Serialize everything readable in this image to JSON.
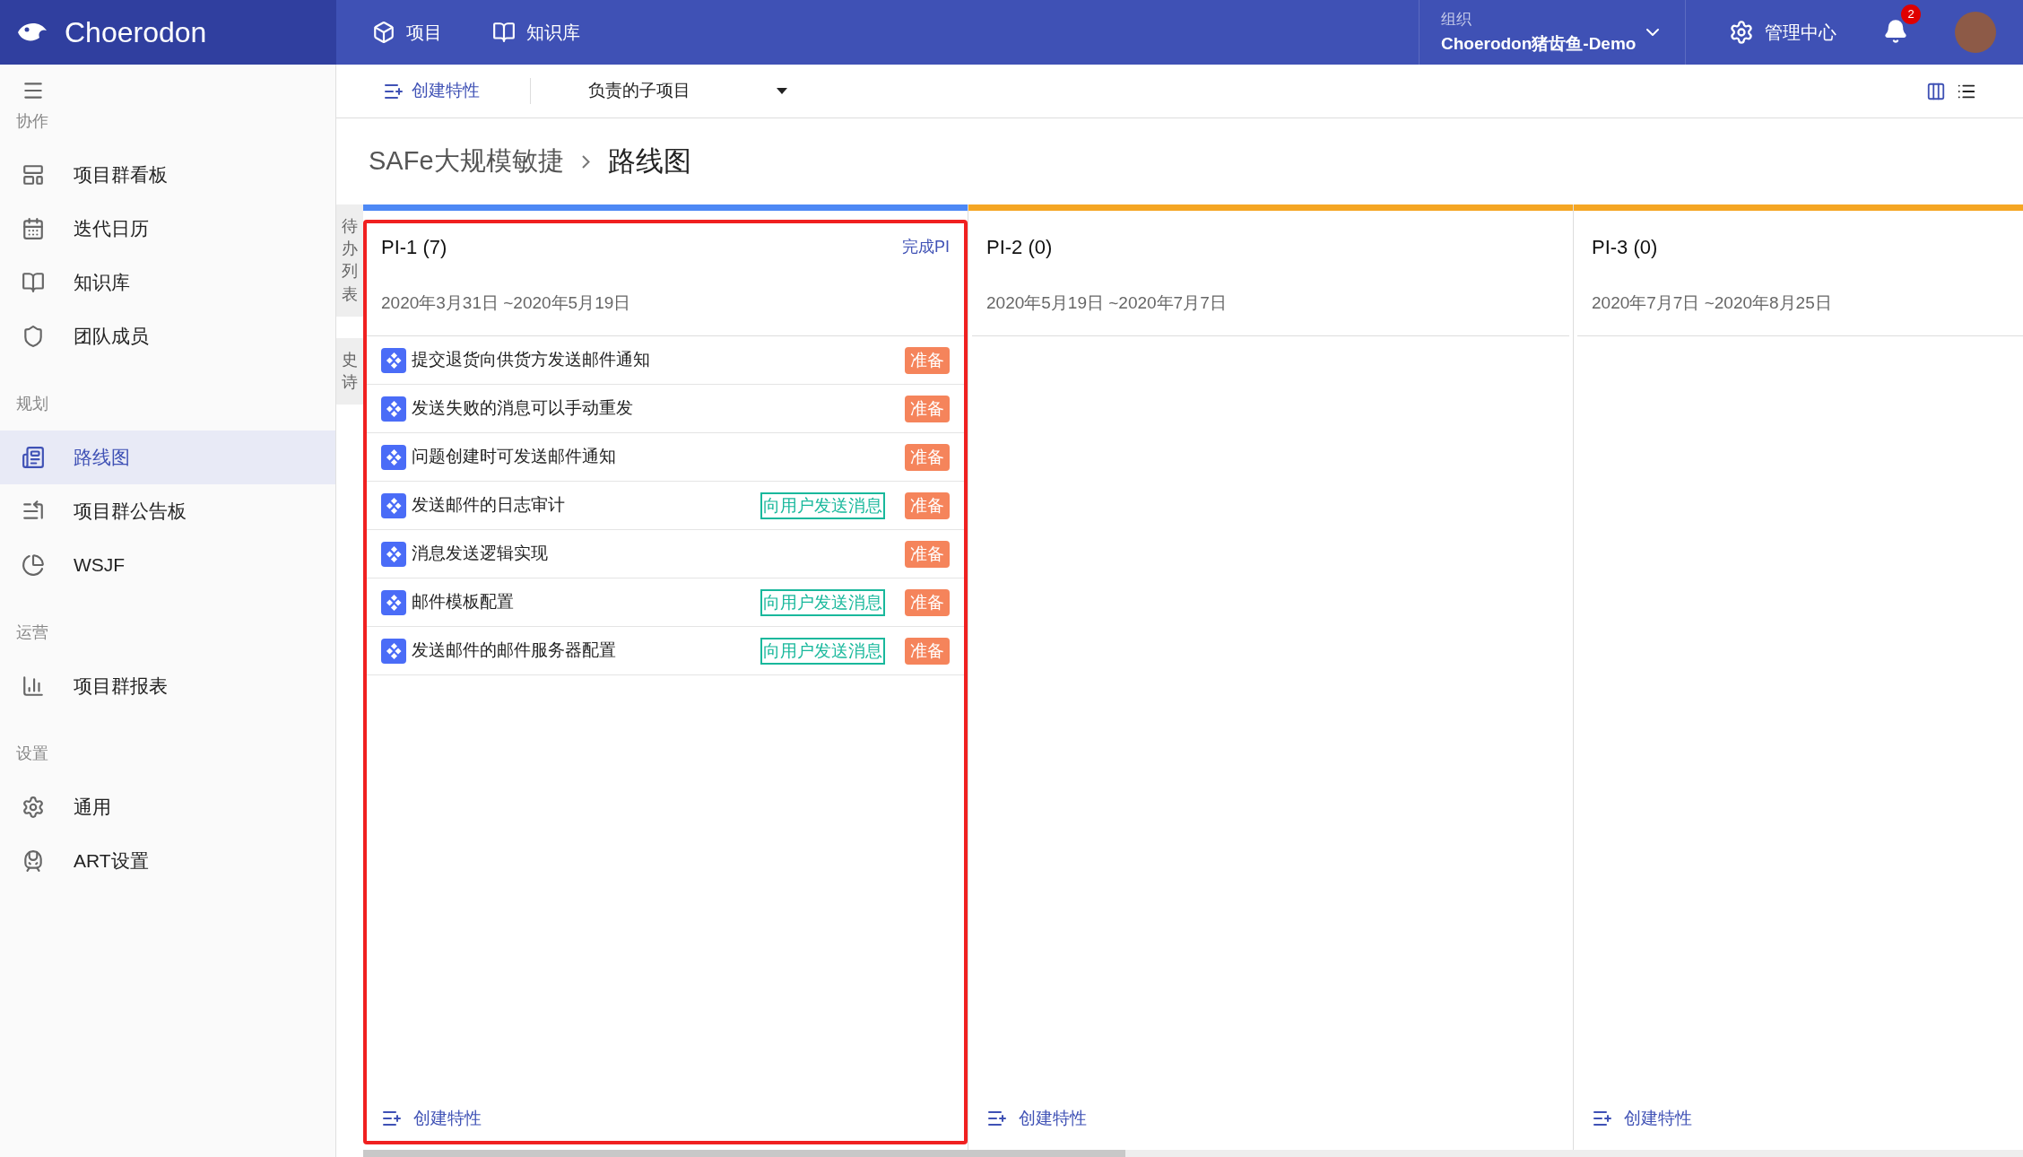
{
  "header": {
    "app_name": "Choerodon",
    "nav": [
      {
        "label": "项目"
      },
      {
        "label": "知识库"
      }
    ],
    "org_label": "组织",
    "org_name": "Choerodon猪齿鱼-Demo",
    "admin": "管理中心",
    "notification_count": "2"
  },
  "sidebar": {
    "sections": [
      {
        "title": "协作",
        "items": [
          {
            "label": "项目群看板",
            "selected": false
          },
          {
            "label": "迭代日历",
            "selected": false
          },
          {
            "label": "知识库",
            "selected": false
          },
          {
            "label": "团队成员",
            "selected": false
          }
        ]
      },
      {
        "title": "规划",
        "items": [
          {
            "label": "路线图",
            "selected": true
          },
          {
            "label": "项目群公告板",
            "selected": false
          },
          {
            "label": "WSJF",
            "selected": false
          }
        ]
      },
      {
        "title": "运营",
        "items": [
          {
            "label": "项目群报表",
            "selected": false
          }
        ]
      },
      {
        "title": "设置",
        "items": [
          {
            "label": "通用",
            "selected": false
          },
          {
            "label": "ART设置",
            "selected": false
          }
        ]
      }
    ]
  },
  "toolbar": {
    "create": "创建特性",
    "filter": "负责的子项目"
  },
  "breadcrumb": [
    "SAFe大规模敏捷",
    "路线图"
  ],
  "side_tabs": [
    "待办列表",
    "史诗"
  ],
  "pis": [
    {
      "title": "PI-1 (7)",
      "color": "#4d88f5",
      "selected": true,
      "action": "完成PI",
      "dates": "2020年3月31日 ~2020年5月19日",
      "create": "创建特性",
      "features": [
        {
          "title": "提交退货向供货方发送邮件通知",
          "status": "准备"
        },
        {
          "title": "发送失败的消息可以手动重发",
          "status": "准备"
        },
        {
          "title": "问题创建时可发送邮件通知",
          "status": "准备"
        },
        {
          "title": "发送邮件的日志审计",
          "epic": "向用户发送消息",
          "status": "准备"
        },
        {
          "title": "消息发送逻辑实现",
          "status": "准备"
        },
        {
          "title": "邮件模板配置",
          "epic": "向用户发送消息",
          "status": "准备"
        },
        {
          "title": "发送邮件的邮件服务器配置",
          "epic": "向用户发送消息",
          "status": "准备"
        }
      ]
    },
    {
      "title": "PI-2 (0)",
      "color": "#f5a623",
      "selected": false,
      "dates": "2020年5月19日 ~2020年7月7日",
      "create": "创建特性"
    },
    {
      "title": "PI-3 (0)",
      "color": "#f5a623",
      "selected": false,
      "dates": "2020年7月7日 ~2020年8月25日",
      "create": "创建特性"
    }
  ]
}
